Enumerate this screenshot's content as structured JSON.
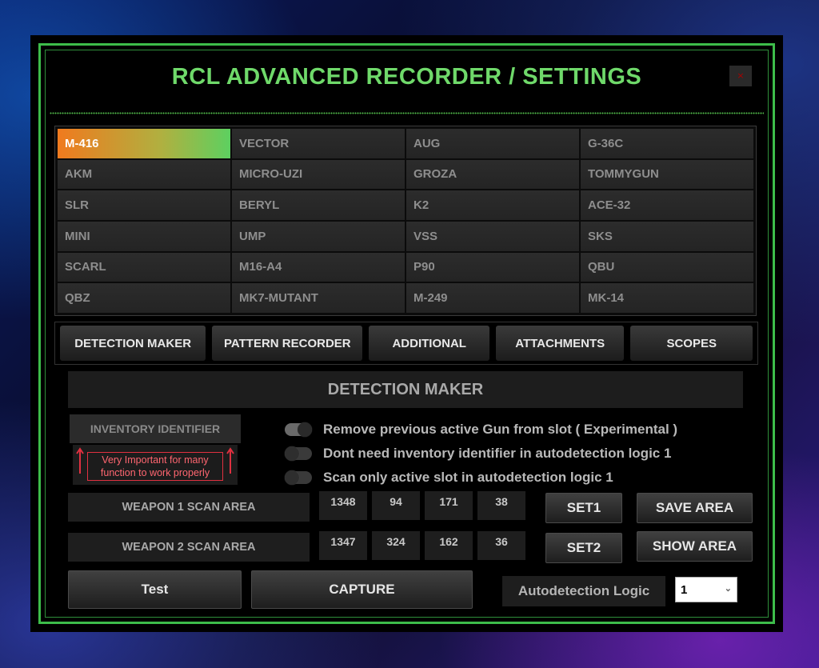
{
  "window": {
    "title": "RCL  ADVANCED RECORDER / SETTINGS",
    "close_glyph": "×"
  },
  "guns": [
    {
      "label": "M-416",
      "active": true
    },
    {
      "label": "VECTOR"
    },
    {
      "label": "AUG"
    },
    {
      "label": "G-36C"
    },
    {
      "label": "AKM"
    },
    {
      "label": "MICRO-UZI"
    },
    {
      "label": "GROZA"
    },
    {
      "label": "TOMMYGUN"
    },
    {
      "label": "SLR"
    },
    {
      "label": "BERYL"
    },
    {
      "label": "K2"
    },
    {
      "label": "ACE-32"
    },
    {
      "label": "MINI"
    },
    {
      "label": "UMP"
    },
    {
      "label": "VSS"
    },
    {
      "label": "SKS"
    },
    {
      "label": "SCARL"
    },
    {
      "label": "M16-A4"
    },
    {
      "label": "P90"
    },
    {
      "label": "QBU"
    },
    {
      "label": "QBZ"
    },
    {
      "label": "MK7-MUTANT"
    },
    {
      "label": "M-249"
    },
    {
      "label": "MK-14"
    }
  ],
  "tabs": [
    "DETECTION MAKER",
    "PATTERN RECORDER",
    "ADDITIONAL",
    "ATTACHMENTS",
    "SCOPES"
  ],
  "section": {
    "title": "DETECTION MAKER",
    "inventory_identifier": "INVENTORY IDENTIFIER",
    "warning_line1": "Very Important for many",
    "warning_line2": "function to work properly",
    "options": [
      {
        "label": "Remove previous active Gun from slot ( Experimental )",
        "on": true
      },
      {
        "label": "Dont need inventory identifier in autodetection logic 1",
        "on": false
      },
      {
        "label": "Scan only active slot in autodetection logic 1",
        "on": false
      }
    ],
    "weapon1": {
      "label": "WEAPON 1 SCAN AREA",
      "values": [
        "1348",
        "94",
        "171",
        "38"
      ]
    },
    "weapon2": {
      "label": "WEAPON 2 SCAN AREA",
      "values": [
        "1347",
        "324",
        "162",
        "36"
      ]
    },
    "buttons": {
      "set1": "SET1",
      "set2": "SET2",
      "save_area": "SAVE AREA",
      "show_area": "SHOW AREA",
      "test": "Test",
      "capture": "CAPTURE"
    },
    "autodetection": {
      "label": "Autodetection Logic",
      "selected": "1"
    }
  },
  "colors": {
    "accent_green": "#3dbd4a",
    "title_green": "#6fd96a",
    "warning_red": "#e03040",
    "active_orange": "#f07a1e"
  }
}
